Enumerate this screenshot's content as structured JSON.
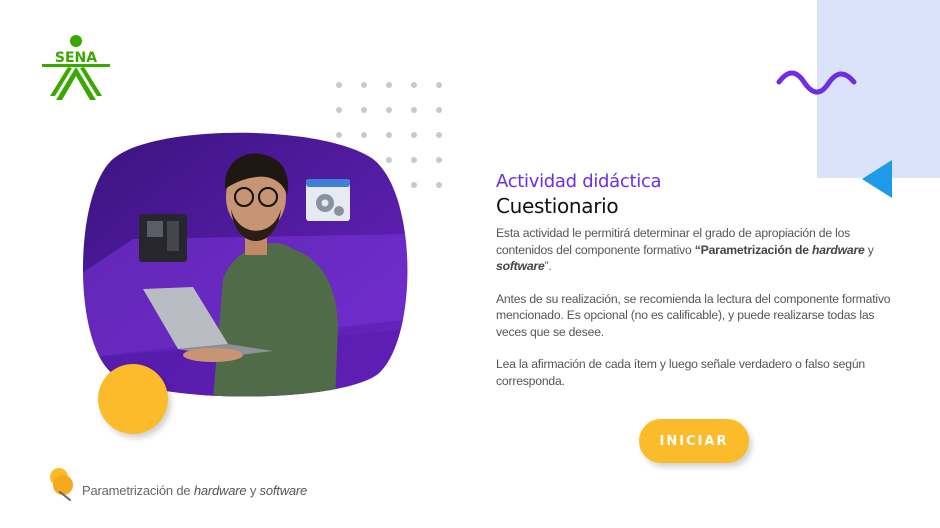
{
  "brand": {
    "logo_text": "SENA",
    "accent": "#39a900"
  },
  "activity": {
    "subtitle": "Actividad didáctica",
    "title": "Cuestionario",
    "para1_a": "Esta actividad le permitirá determinar el grado de apropiación de los contenidos del componente formativo ",
    "para1_b": "“Parametrización de ",
    "para1_c": "hardware",
    "para1_d": " y ",
    "para1_e": "software",
    "para1_f": "”.",
    "para2": "Antes de su realización, se recomienda la lectura del componente formativo mencionado.  Es opcional (no es calificable), y puede realizarse todas las veces que se desee.",
    "para3": "Lea la afirmación de cada ítem y luego señale verdadero o falso según corresponda."
  },
  "actions": {
    "start_label": "INICIAR"
  },
  "footer": {
    "text_a": "Parametrización de ",
    "text_b": "hardware",
    "text_c": " y ",
    "text_d": "software"
  },
  "colors": {
    "purple": "#6d2ee6",
    "yellow": "#fbbb2a",
    "light_blue_panel": "#dbe3fb",
    "blue_triangle": "#1e9be8",
    "hero_purple": "#4b1a9c"
  },
  "icons": [
    "sena-logo-icon",
    "wave-icon",
    "triangle-icon",
    "dot-grid",
    "motherboard-icon",
    "gear-window-icon",
    "pin-icon"
  ]
}
